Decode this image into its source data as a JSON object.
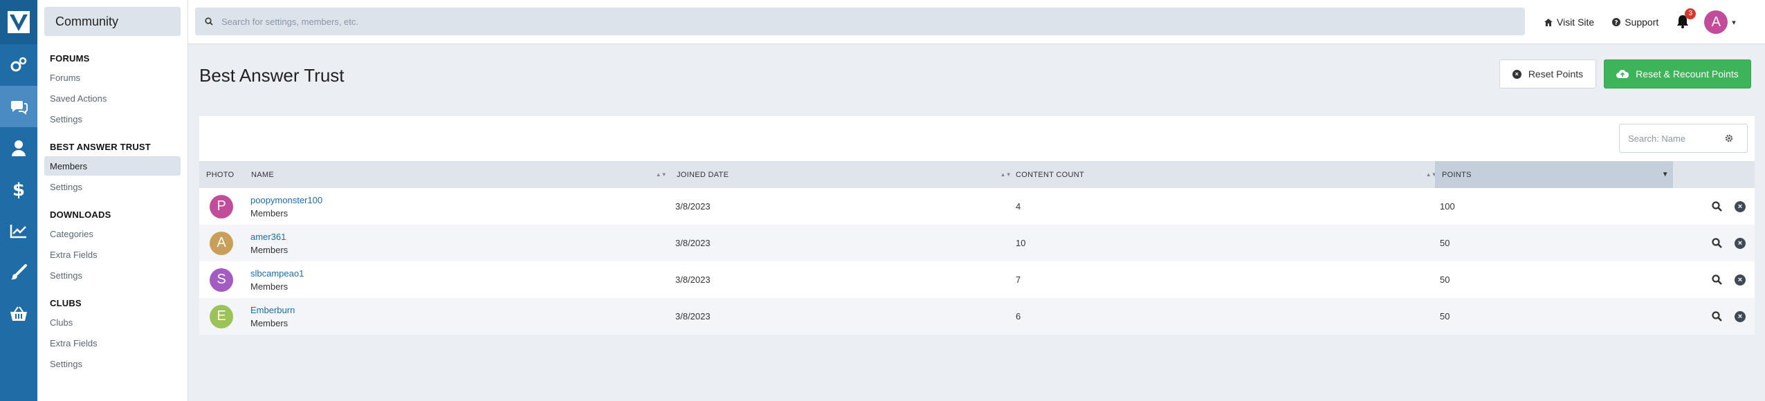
{
  "app": {
    "section_title": "Community"
  },
  "search": {
    "placeholder": "Search for settings, members, etc."
  },
  "top_links": {
    "visit_site": "Visit Site",
    "support": "Support",
    "notification_count": "3",
    "avatar_letter": "A"
  },
  "sidebar": {
    "sections": [
      {
        "heading": "FORUMS",
        "items": [
          "Forums",
          "Saved Actions",
          "Settings"
        ]
      },
      {
        "heading": "BEST ANSWER TRUST",
        "items": [
          "Members",
          "Settings"
        ]
      },
      {
        "heading": "DOWNLOADS",
        "items": [
          "Categories",
          "Extra Fields",
          "Settings"
        ]
      },
      {
        "heading": "CLUBS",
        "items": [
          "Clubs",
          "Extra Fields",
          "Settings"
        ]
      }
    ],
    "active_item": "BEST ANSWER TRUST / Members"
  },
  "page": {
    "title": "Best Answer Trust",
    "reset_button": "Reset Points",
    "recount_button": "Reset & Recount Points",
    "table_search_placeholder": "Search: Name"
  },
  "table": {
    "columns": [
      "PHOTO",
      "NAME",
      "JOINED DATE",
      "CONTENT COUNT",
      "POINTS"
    ],
    "sorted_column": "POINTS",
    "rows": [
      {
        "avatar_letter": "P",
        "avatar_color": "#c24c9a",
        "name": "poopymonster100",
        "group": "Members",
        "joined": "3/8/2023",
        "content_count": "4",
        "points": "100"
      },
      {
        "avatar_letter": "A",
        "avatar_color": "#c9a05a",
        "name": "amer361",
        "group": "Members",
        "joined": "3/8/2023",
        "content_count": "10",
        "points": "50"
      },
      {
        "avatar_letter": "S",
        "avatar_color": "#a35cc2",
        "name": "slbcampeao1",
        "group": "Members",
        "joined": "3/8/2023",
        "content_count": "7",
        "points": "50"
      },
      {
        "avatar_letter": "E",
        "avatar_color": "#9cc25a",
        "name": "Emberburn",
        "group": "Members",
        "joined": "3/8/2023",
        "content_count": "6",
        "points": "50"
      }
    ]
  },
  "colors": {
    "sidebar_blue": "#1f6ca6",
    "green_button": "#3db45a",
    "notification_badge": "#d33a2c"
  }
}
